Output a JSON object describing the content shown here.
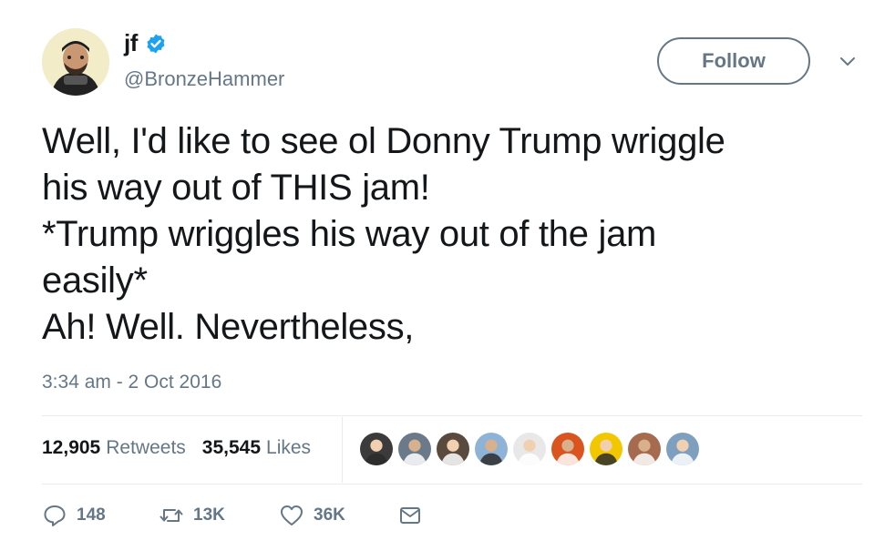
{
  "user": {
    "display_name": "jf",
    "handle": "@BronzeHammer",
    "verified": true
  },
  "follow_label": "Follow",
  "tweet": {
    "lines": [
      "Well, I'd like to see ol Donny Trump wriggle",
      "his way out of THIS jam!",
      "*Trump wriggles his way out of the jam",
      "easily*",
      "Ah! Well. Nevertheless,"
    ],
    "timestamp": "3:34 am - 2 Oct 2016"
  },
  "stats": {
    "retweets_count": "12,905",
    "retweets_label": "Retweets",
    "likes_count": "35,545",
    "likes_label": "Likes"
  },
  "liker_avatars": [
    {
      "icon": "avatar-1",
      "color": "#3b3b3b"
    },
    {
      "icon": "avatar-2",
      "color": "#6b7a8a"
    },
    {
      "icon": "avatar-3",
      "color": "#5a4a3e"
    },
    {
      "icon": "avatar-4",
      "color": "#8fb3d6"
    },
    {
      "icon": "avatar-5",
      "color": "#e8e8e8"
    },
    {
      "icon": "avatar-6",
      "color": "#d9541e"
    },
    {
      "icon": "avatar-7",
      "color": "#f2c700"
    },
    {
      "icon": "avatar-8",
      "color": "#a66b4f"
    },
    {
      "icon": "avatar-9",
      "color": "#7f9fbf"
    }
  ],
  "actions": {
    "reply_count": "148",
    "retweet_count": "13K",
    "like_count": "36K"
  },
  "colors": {
    "text": "#14171a",
    "secondary": "#657786",
    "verified_blue": "#1da1f2",
    "divider": "#e6ecf0"
  }
}
